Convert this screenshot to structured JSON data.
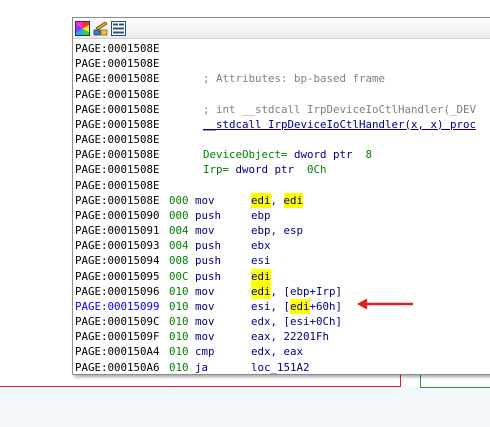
{
  "colors": {
    "highlight": "#ffff00",
    "address": "#000000",
    "current_address": "#0000ff",
    "stack_pointer": "#008000",
    "instruction": "#000080",
    "comment": "#808080",
    "arrow": "#e02020"
  },
  "toolbar": {
    "icons": [
      "palette-icon",
      "edit-graph-icon",
      "graph-overview-icon"
    ]
  },
  "listing": {
    "lines": [
      {
        "addr": "PAGE:0001508E"
      },
      {
        "addr": "PAGE:0001508E"
      },
      {
        "addr": "PAGE:0001508E",
        "comment": "; Attributes: bp-based frame"
      },
      {
        "addr": "PAGE:0001508E"
      },
      {
        "addr": "PAGE:0001508E",
        "comment": "; int __stdcall IrpDeviceIoCtlHandler(_DEV"
      },
      {
        "addr": "PAGE:0001508E",
        "decl": "__stdcall IrpDeviceIoCtlHandler(x, x) proc"
      },
      {
        "addr": "PAGE:0001508E"
      },
      {
        "addr": "PAGE:0001508E",
        "var_name": "DeviceObject=",
        "var_type": " dword ptr ",
        "var_off": " 8"
      },
      {
        "addr": "PAGE:0001508E",
        "var_name": "Irp=",
        "var_type": " dword ptr ",
        "var_off": " 0Ch"
      },
      {
        "addr": "PAGE:0001508E"
      },
      {
        "addr": "PAGE:0001508E",
        "sp": "000",
        "mnem": "mov",
        "op1_hl": "edi",
        "sep": ", ",
        "op2_hl": "edi"
      },
      {
        "addr": "PAGE:00015090",
        "sp": "000",
        "mnem": "push",
        "ops": "ebp"
      },
      {
        "addr": "PAGE:00015091",
        "sp": "004",
        "mnem": "mov",
        "ops": "ebp, esp"
      },
      {
        "addr": "PAGE:00015093",
        "sp": "004",
        "mnem": "push",
        "ops": "ebx"
      },
      {
        "addr": "PAGE:00015094",
        "sp": "008",
        "mnem": "push",
        "ops": "esi"
      },
      {
        "addr": "PAGE:00015095",
        "sp": "00C",
        "mnem": "push",
        "op1_hl": "edi"
      },
      {
        "addr": "PAGE:00015096",
        "sp": "010",
        "mnem": "mov",
        "op1_hl": "edi",
        "rest": ", [ebp+Irp]"
      },
      {
        "addr": "PAGE:00015099",
        "sp": "010",
        "mnem": "mov",
        "pre": "esi, [",
        "mid_hl": "edi",
        "post": "+60h]",
        "current": true
      },
      {
        "addr": "PAGE:0001509C",
        "sp": "010",
        "mnem": "mov",
        "ops": "edx, [esi+0Ch]"
      },
      {
        "addr": "PAGE:0001509F",
        "sp": "010",
        "mnem": "mov",
        "ops": "eax, 22201Fh"
      },
      {
        "addr": "PAGE:000150A4",
        "sp": "010",
        "mnem": "cmp",
        "ops": "edx, eax"
      },
      {
        "addr": "PAGE:000150A6",
        "sp": "010",
        "mnem": "ja",
        "ops": "loc_151A2"
      }
    ]
  }
}
